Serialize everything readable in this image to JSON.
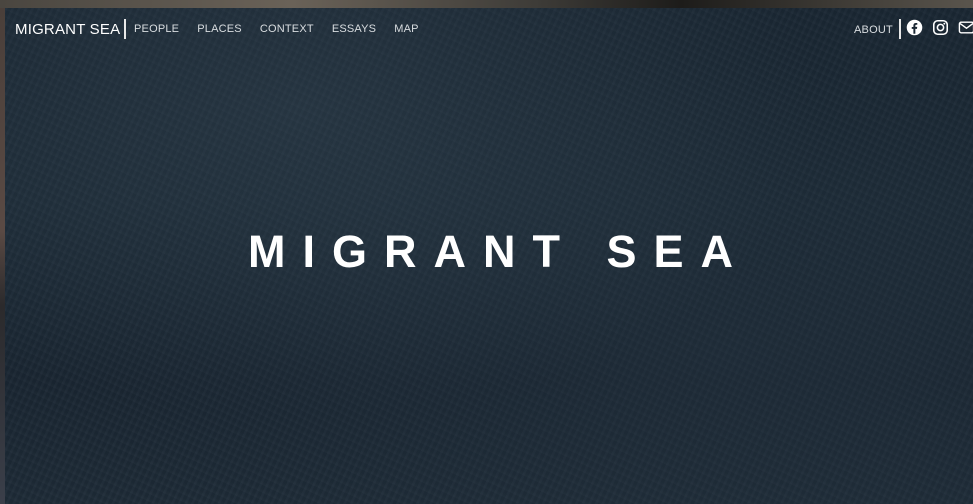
{
  "nav": {
    "brand": "MIGRANT SEA",
    "links": [
      "PEOPLE",
      "PLACES",
      "CONTEXT",
      "ESSAYS",
      "MAP"
    ],
    "about": "ABOUT",
    "icons": [
      "facebook-icon",
      "instagram-icon",
      "mail-icon"
    ]
  },
  "hero": {
    "title": "MIGRANT SEA"
  },
  "colors": {
    "background": "#1b2834",
    "text": "#ffffff",
    "nav_text": "#d9dde0"
  }
}
